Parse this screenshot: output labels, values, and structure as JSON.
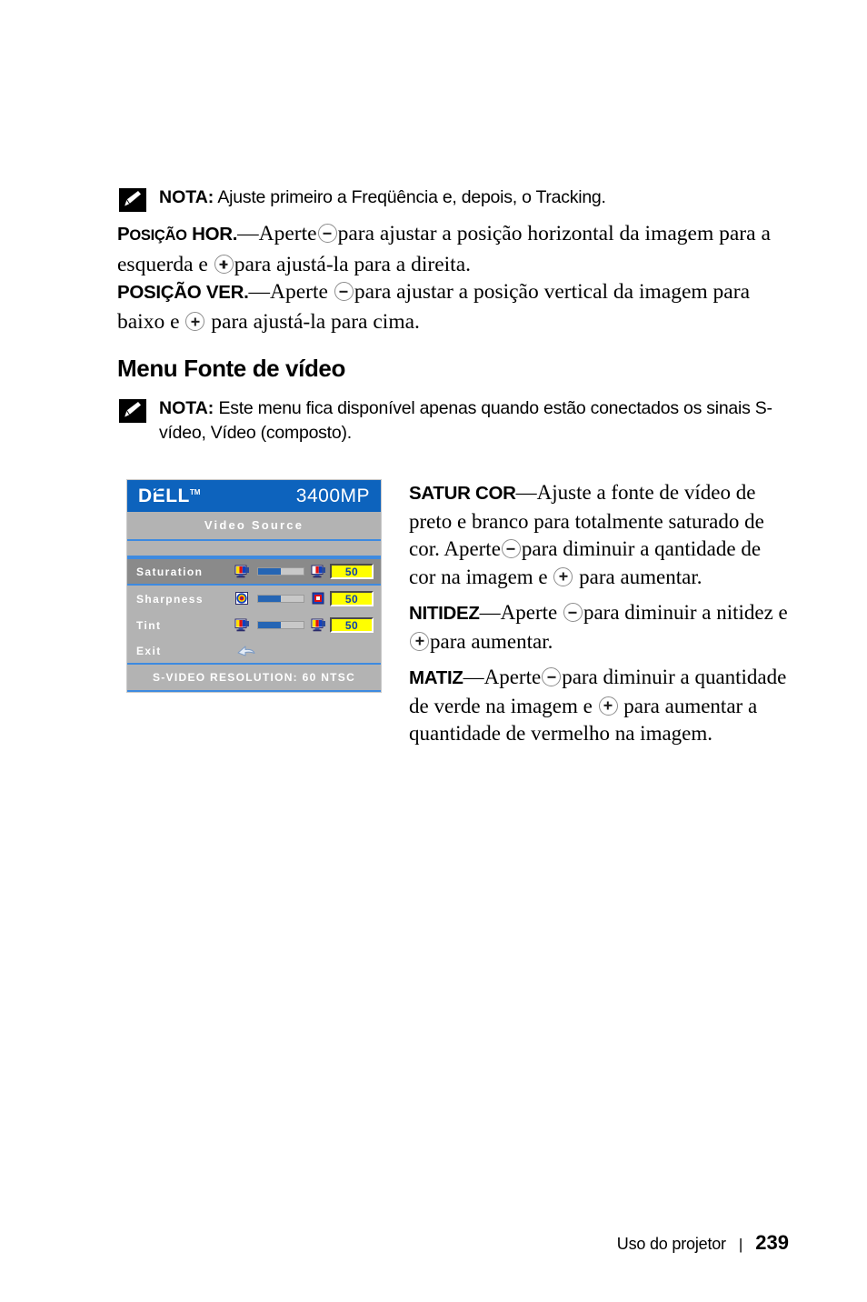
{
  "notes": [
    {
      "icon": "pencil-note-icon",
      "label": "NOTA:",
      "text": "Ajuste primeiro a Freqüência e, depois, o Tracking."
    },
    {
      "icon": "pencil-note-icon",
      "label": "NOTA:",
      "text": "Este menu fica disponível apenas quando estão conectados os sinais S-vídeo, Vídeo (composto)."
    }
  ],
  "paragraphs": {
    "posicao_hor": {
      "term": "Posição HOR.",
      "term_small_caps": "OSIÇÃO",
      "seg1": "—Aperte",
      "minus_icon": "minus-circle-icon",
      "seg2": "para ajustar a posição horizontal da imagem para a esquerda e",
      "plus_icon": "plus-circle-icon",
      "seg3": "para ajustá-la para a direita."
    },
    "posicao_ver": {
      "term": "POSIÇÃO VER.",
      "seg1": "—Aperte",
      "minus_icon": "minus-circle-icon",
      "seg2": "para ajustar a posição vertical da imagem para baixo e",
      "plus_icon": "plus-circle-icon",
      "seg3": "para ajustá-la para cima."
    }
  },
  "section": {
    "heading": "Menu Fonte de vídeo"
  },
  "osd": {
    "brand": "DELL",
    "brand_tm": "TM",
    "model": "3400MP",
    "title": "Video Source",
    "rows": [
      {
        "label": "Saturation",
        "value": "50",
        "selected": true,
        "icon_left": "color-display-icon",
        "icon_right": "color-display-icon",
        "fill_percent": 50
      },
      {
        "label": "Sharpness",
        "value": "50",
        "selected": false,
        "icon_left": "bullseye-target-icon",
        "icon_right": "square-target-icon",
        "fill_percent": 50
      },
      {
        "label": "Tint",
        "value": "50",
        "selected": false,
        "icon_left": "color-display-icon",
        "icon_right": "color-display-icon",
        "fill_percent": 50
      }
    ],
    "exit": {
      "label": "Exit",
      "icon": "return-arrow-icon"
    },
    "footer": "S-VIDEO RESOLUTION: 60 NTSC",
    "colors": {
      "header_blue": "#0d63bd",
      "panel_gray": "#b3b3b3",
      "selected_gray": "#8a8a8a",
      "divider_blue": "#3d8ae0",
      "slider_fill": "#2565b4",
      "value_bg": "#ffff00",
      "value_text": "#0a3fb0"
    }
  },
  "descriptions": {
    "satur_cor": {
      "term": "SATUR COR",
      "seg1": "—Ajuste a fonte de vídeo de preto e branco para totalmente saturado de cor. Aperte",
      "minus_icon": "minus-circle-icon",
      "seg2": "para diminuir a qantidade de cor na imagem e",
      "plus_icon": "plus-circle-icon",
      "seg3": "para aumentar."
    },
    "nitidez": {
      "term": "NITIDEZ",
      "seg1": "—Aperte",
      "minus_icon": "minus-circle-icon",
      "seg2": "para diminuir a nitidez e",
      "plus_icon": "plus-circle-icon",
      "seg3": "para aumentar."
    },
    "matiz": {
      "term": "MATIZ",
      "seg1": "—Aperte",
      "minus_icon": "minus-circle-icon",
      "seg2": "para diminuir a quantidade de verde na imagem e",
      "plus_icon": "plus-circle-icon",
      "seg3": "para aumentar a quantidade de vermelho na imagem."
    }
  },
  "footer": {
    "section_label": "Uso do projetor",
    "separator": "|",
    "page_number": "239"
  }
}
